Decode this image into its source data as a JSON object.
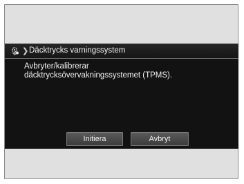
{
  "dialog": {
    "title": "Däcktrycks varningssystem",
    "message_line1": "Avbryter/kalibrerar",
    "message_line2": "däcktrycksövervakningssystemet (TPMS).",
    "buttons": {
      "initiate_label": "Initiera",
      "cancel_label": "Avbryt"
    }
  },
  "icons": {
    "title_icon": "settings-gear-icon",
    "breadcrumb_separator": "chevron-right-icon"
  },
  "colors": {
    "screen_background": "#121212",
    "text": "#f2f2f2",
    "button_background": "#4a4a4a",
    "frame_background": "#e0e0e0"
  }
}
